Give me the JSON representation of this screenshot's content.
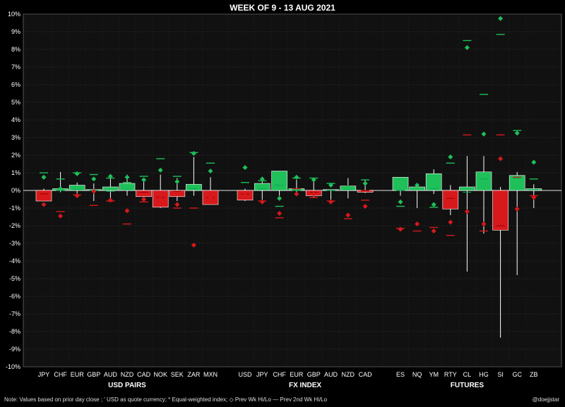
{
  "title": "WEEK OF  9 - 13  AUG 2021",
  "note": "Note:  Values based on prior day close ;  ' USD as quote currency;   * Equal-weighted index;  ◇ Prev Wk Hi/Lo     — Prev 2nd Wk Hi/Lo",
  "credit": "@doejjstar",
  "colors": {
    "up": "#1fbf5a",
    "down": "#d7191c",
    "grid": "#3a3a3a",
    "background": "#000000"
  },
  "chart_data": {
    "type": "candlestick",
    "ylim": [
      -10,
      10
    ],
    "ytick_step": 1,
    "ytick_format": "percent",
    "groups": [
      {
        "label": "USD PAIRS",
        "start": 0,
        "end": 11
      },
      {
        "label": "FX INDEX",
        "start": 11,
        "end": 19
      },
      {
        "label": "FUTURES",
        "start": 19,
        "end": 28
      }
    ],
    "instruments": [
      {
        "label": "JPY",
        "close": -0.6,
        "high": 0.1,
        "low": -0.6,
        "mark": -0.2,
        "pw_hi": 0.75,
        "pw_lo": -0.8,
        "p2_hi": 1.0,
        "p2_lo": -0.3
      },
      {
        "label": "CHF",
        "close": 0.1,
        "high": 1.05,
        "low": -0.1,
        "mark": 0.0,
        "pw_hi": 0.1,
        "pw_lo": -1.45,
        "p2_hi": 0.65,
        "p2_lo": -1.2
      },
      {
        "label": "EUR",
        "close": 0.3,
        "high": 0.45,
        "low": -0.3,
        "mark": 0.05,
        "pw_hi": 0.95,
        "pw_lo": -0.3,
        "p2_hi": 1.0,
        "p2_lo": -0.25
      },
      {
        "label": "GBP",
        "close": 0.05,
        "high": 0.4,
        "low": -0.6,
        "mark": 0.0,
        "pw_hi": 0.65,
        "pw_lo": -0.05,
        "p2_hi": 0.9,
        "p2_lo": -0.85
      },
      {
        "label": "AUD",
        "close": 0.2,
        "high": 0.8,
        "low": -0.55,
        "mark": -0.05,
        "pw_hi": 0.8,
        "pw_lo": -0.55,
        "p2_hi": 0.7,
        "p2_lo": -0.6
      },
      {
        "label": "NZD",
        "close": 0.4,
        "high": 0.9,
        "low": -0.3,
        "mark": 0.05,
        "pw_hi": 0.75,
        "pw_lo": -1.15,
        "p2_hi": 0.45,
        "p2_lo": -1.9
      },
      {
        "label": "CAD",
        "close": -0.35,
        "high": 0.6,
        "low": -0.65,
        "mark": -0.1,
        "pw_hi": 0.6,
        "pw_lo": -0.5,
        "p2_hi": 0.8,
        "p2_lo": -0.65
      },
      {
        "label": "NOK",
        "close": -0.95,
        "high": 0.9,
        "low": -1.0,
        "mark": -0.4,
        "pw_hi": 1.15,
        "pw_lo": -0.45,
        "p2_hi": 1.8,
        "p2_lo": -0.9
      },
      {
        "label": "SEK",
        "close": -0.35,
        "high": 0.7,
        "low": -0.6,
        "mark": -0.05,
        "pw_hi": 0.5,
        "pw_lo": -0.8,
        "p2_hi": 0.8,
        "p2_lo": -1.0
      },
      {
        "label": "ZAR",
        "close": 0.35,
        "high": 1.9,
        "low": -0.3,
        "mark": 0.1,
        "pw_hi": 2.1,
        "pw_lo": -3.1,
        "p2_hi": 2.15,
        "p2_lo": -1.0
      },
      {
        "label": "MXN",
        "close": -0.8,
        "high": 0.75,
        "low": -0.8,
        "mark": -0.4,
        "pw_hi": 1.1,
        "pw_lo": -0.4,
        "p2_hi": 1.55,
        "p2_lo": -0.5
      },
      {
        "label": "USD",
        "close": -0.55,
        "high": 0.1,
        "low": -0.6,
        "mark": -0.2,
        "pw_hi": 1.3,
        "pw_lo": -0.15,
        "p2_hi": 0.45,
        "p2_lo": -0.3
      },
      {
        "label": "JPY",
        "close": 0.4,
        "high": 0.55,
        "low": -0.6,
        "mark": 0.1,
        "pw_hi": 0.65,
        "pw_lo": -0.65,
        "p2_hi": 0.55,
        "p2_lo": -0.6
      },
      {
        "label": "CHF",
        "close": 1.1,
        "high": 1.1,
        "low": -0.3,
        "mark": 0.3,
        "pw_hi": -0.45,
        "pw_lo": -1.3,
        "p2_hi": -0.9,
        "p2_lo": -1.55
      },
      {
        "label": "EUR",
        "close": 0.1,
        "high": 0.6,
        "low": -0.3,
        "mark": 0.0,
        "pw_hi": 0.75,
        "pw_lo": -0.2,
        "p2_hi": 0.7,
        "p2_lo": 0.1
      },
      {
        "label": "GBP",
        "close": -0.3,
        "high": 0.55,
        "low": -0.4,
        "mark": -0.1,
        "pw_hi": 0.6,
        "pw_lo": -0.2,
        "p2_hi": 0.7,
        "p2_lo": -0.4
      },
      {
        "label": "AUD",
        "close": 0.05,
        "high": 0.05,
        "low": -0.55,
        "mark": 0.0,
        "pw_hi": 0.3,
        "pw_lo": -0.65,
        "p2_hi": 0.4,
        "p2_lo": -0.6
      },
      {
        "label": "NZD",
        "close": 0.25,
        "high": 0.7,
        "low": -0.45,
        "mark": 0.05,
        "pw_hi": 0.2,
        "pw_lo": -1.4,
        "p2_hi": 0.1,
        "p2_lo": -1.6
      },
      {
        "label": "CAD",
        "close": -0.1,
        "high": 0.6,
        "low": -0.15,
        "mark": 0.0,
        "pw_hi": 0.4,
        "pw_lo": -0.9,
        "p2_hi": 0.6,
        "p2_lo": -0.55
      },
      {
        "label": "ES",
        "close": 0.75,
        "high": 0.75,
        "low": -0.3,
        "mark": 0.0,
        "pw_hi": -0.65,
        "pw_lo": -2.2,
        "p2_hi": -0.9,
        "p2_lo": -2.15
      },
      {
        "label": "NQ",
        "close": 0.2,
        "high": 0.35,
        "low": -1.0,
        "mark": 0.1,
        "pw_hi": 0.3,
        "pw_lo": -1.9,
        "p2_hi": 0.1,
        "p2_lo": -2.3
      },
      {
        "label": "YM",
        "close": 0.95,
        "high": 1.2,
        "low": -0.2,
        "mark": 0.1,
        "pw_hi": -0.8,
        "pw_lo": -2.3,
        "p2_hi": -0.95,
        "p2_lo": -2.1
      },
      {
        "label": "RTY",
        "close": -1.05,
        "high": 0.3,
        "low": -1.4,
        "mark": -0.45,
        "pw_hi": 1.9,
        "pw_lo": -1.8,
        "p2_hi": 1.55,
        "p2_lo": -2.55
      },
      {
        "label": "CL",
        "close": 0.2,
        "high": 1.95,
        "low": -4.6,
        "mark": -0.1,
        "pw_hi": 8.1,
        "pw_lo": -1.2,
        "p2_hi": 8.5,
        "p2_lo": 3.15
      },
      {
        "label": "HG",
        "close": 1.05,
        "high": 1.95,
        "low": -2.45,
        "mark": 0.65,
        "pw_hi": 3.2,
        "pw_lo": -1.9,
        "p2_hi": 5.45,
        "p2_lo": -2.3
      },
      {
        "label": "SI",
        "close": -2.25,
        "high": 0.2,
        "low": -8.35,
        "mark": -2.0,
        "pw_hi": 9.75,
        "pw_lo": 1.8,
        "p2_hi": 8.85,
        "p2_lo": 3.15
      },
      {
        "label": "GC",
        "close": 0.85,
        "high": 1.05,
        "low": -4.8,
        "mark": 0.7,
        "pw_hi": 3.25,
        "pw_lo": -1.05,
        "p2_hi": 3.4,
        "p2_lo": 0.75
      },
      {
        "label": "ZB",
        "close": 0.1,
        "high": 0.35,
        "low": -1.0,
        "mark": 0.05,
        "pw_hi": 1.6,
        "pw_lo": -0.4,
        "p2_hi": 0.65,
        "p2_lo": -0.3
      }
    ]
  }
}
